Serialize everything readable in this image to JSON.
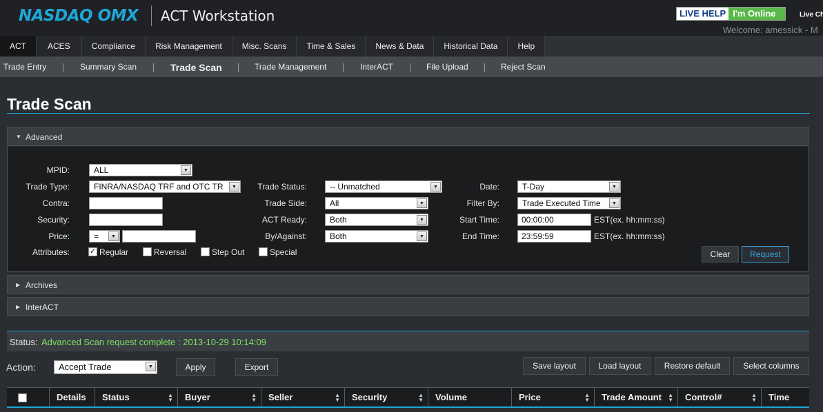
{
  "header": {
    "logo": "NASDAQ OMX",
    "app_title": "ACT Workstation",
    "live_help": "LIVE HELP",
    "online": "I'm Online",
    "live_chat": "Live Ch",
    "welcome": "Welcome: amessick - M"
  },
  "main_nav": {
    "tabs": [
      "ACT",
      "ACES",
      "Compliance",
      "Risk Management",
      "Misc. Scans",
      "Time & Sales",
      "News & Data",
      "Historical Data",
      "Help"
    ],
    "active": "ACT"
  },
  "sub_nav": {
    "items": [
      "Trade Entry",
      "Summary Scan",
      "Trade Scan",
      "Trade Management",
      "InterACT",
      "File Upload",
      "Reject Scan"
    ],
    "active": "Trade Scan"
  },
  "page": {
    "title": "Trade Scan"
  },
  "panels": {
    "advanced": "Advanced",
    "archives": "Archives",
    "interact": "InterACT"
  },
  "form": {
    "mpid_label": "MPID:",
    "mpid_value": "ALL",
    "trade_type_label": "Trade Type:",
    "trade_type_value": "FINRA/NASDAQ TRF and OTC TR",
    "contra_label": "Contra:",
    "contra_value": "",
    "security_label": "Security:",
    "security_value": "",
    "price_label": "Price:",
    "price_op": "=",
    "price_value": "",
    "attributes_label": "Attributes:",
    "attributes": [
      {
        "label": "Regular",
        "checked": true
      },
      {
        "label": "Reversal",
        "checked": false
      },
      {
        "label": "Step Out",
        "checked": false
      },
      {
        "label": "Special",
        "checked": false
      }
    ],
    "trade_status_label": "Trade Status:",
    "trade_status_value": "-- Unmatched",
    "trade_side_label": "Trade Side:",
    "trade_side_value": "All",
    "act_ready_label": "ACT Ready:",
    "act_ready_value": "Both",
    "by_against_label": "By/Against:",
    "by_against_value": "Both",
    "date_label": "Date:",
    "date_value": "T-Day",
    "filter_by_label": "Filter By:",
    "filter_by_value": "Trade Executed Time",
    "start_time_label": "Start Time:",
    "start_time_value": "00:00:00",
    "end_time_label": "End Time:",
    "end_time_value": "23:59:59",
    "time_hint": "EST(ex. hh:mm:ss)",
    "clear_label": "Clear",
    "request_label": "Request"
  },
  "status": {
    "label": "Status:",
    "message": "Advanced Scan request complete : 2013-10-29 10:14:09"
  },
  "actions": {
    "action_label": "Action:",
    "action_value": "Accept Trade",
    "apply_label": "Apply",
    "export_label": "Export",
    "save_layout": "Save layout",
    "load_layout": "Load layout",
    "restore_default": "Restore default",
    "select_columns": "Select columns"
  },
  "grid": {
    "columns": [
      "Details",
      "Status",
      "Buyer",
      "Seller",
      "Security",
      "Volume",
      "Price",
      "Trade Amount",
      "Control#",
      "Time"
    ]
  },
  "colors": {
    "accent": "#1ea6d8",
    "status_ok": "#7ee36a",
    "online": "#58b948"
  }
}
